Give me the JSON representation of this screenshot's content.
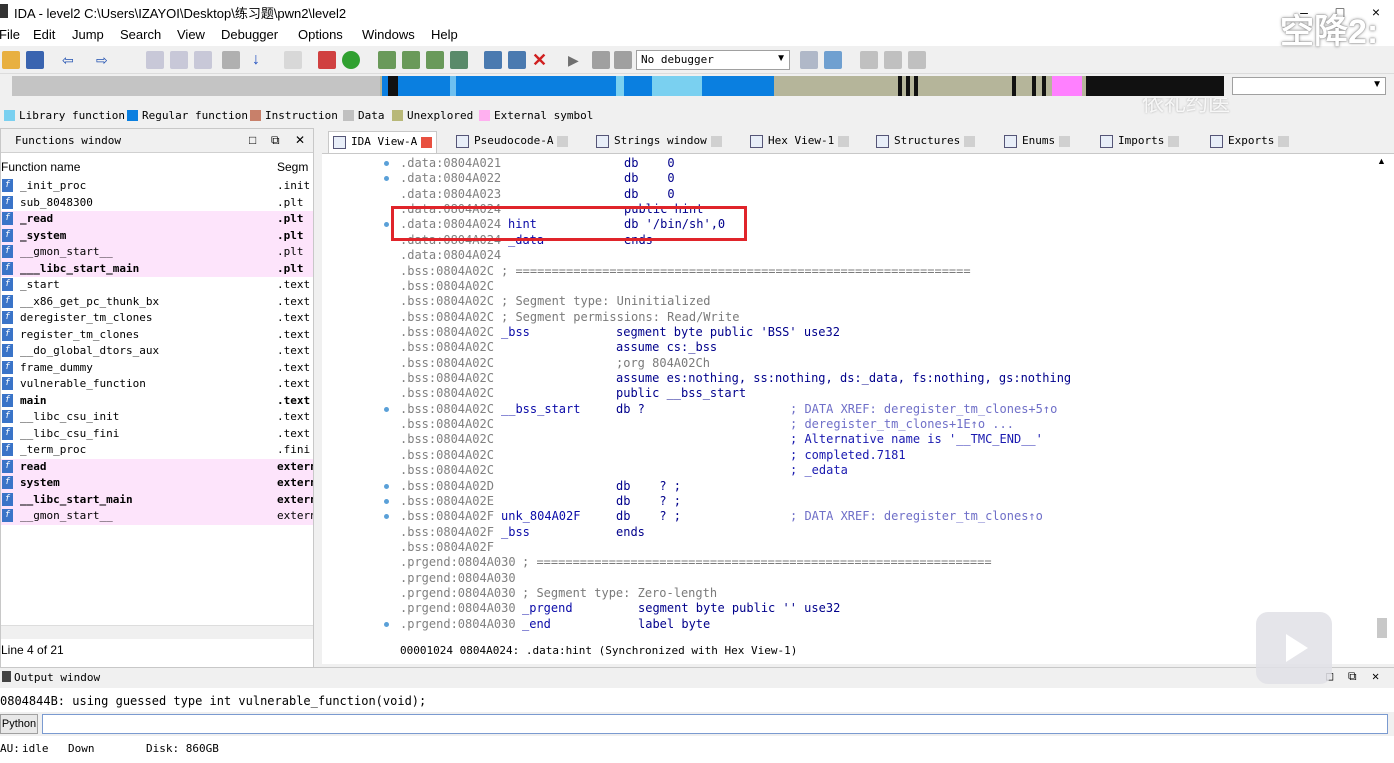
{
  "window": {
    "title": "IDA - level2 C:\\Users\\IZAYOI\\Desktop\\练习题\\pwn2\\level2"
  },
  "watermark": {
    "text": "空降2:",
    "sub": "依礼约医"
  },
  "menu": [
    "File",
    "Edit",
    "Jump",
    "Search",
    "View",
    "Debugger",
    "Options",
    "Windows",
    "Help"
  ],
  "toolbar": {
    "debugger": "No debugger"
  },
  "legend": [
    {
      "label": "Library function",
      "color": "#7ad0f0"
    },
    {
      "label": "Regular function",
      "color": "#0a7fe0"
    },
    {
      "label": "Instruction",
      "color": "#c8806a"
    },
    {
      "label": "Data",
      "color": "#c0c0c0"
    },
    {
      "label": "Unexplored",
      "color": "#b8b878"
    },
    {
      "label": "External symbol",
      "color": "#ffb0f0"
    }
  ],
  "functions_window": {
    "title": "Functions window",
    "col_name": "Function name",
    "col_seg": "Segm",
    "status": "Line 4 of 21",
    "rows": [
      {
        "name": "_init_proc",
        "seg": ".init",
        "pink": false,
        "bold": false
      },
      {
        "name": "sub_8048300",
        "seg": ".plt",
        "pink": false,
        "bold": false
      },
      {
        "name": "_read",
        "seg": ".plt",
        "pink": true,
        "bold": true
      },
      {
        "name": "_system",
        "seg": ".plt",
        "pink": true,
        "bold": true
      },
      {
        "name": "__gmon_start__",
        "seg": ".plt",
        "pink": true,
        "bold": false
      },
      {
        "name": "___libc_start_main",
        "seg": ".plt",
        "pink": true,
        "bold": true
      },
      {
        "name": "_start",
        "seg": ".text",
        "pink": false,
        "bold": false
      },
      {
        "name": "__x86_get_pc_thunk_bx",
        "seg": ".text",
        "pink": false,
        "bold": false
      },
      {
        "name": "deregister_tm_clones",
        "seg": ".text",
        "pink": false,
        "bold": false
      },
      {
        "name": "register_tm_clones",
        "seg": ".text",
        "pink": false,
        "bold": false
      },
      {
        "name": "__do_global_dtors_aux",
        "seg": ".text",
        "pink": false,
        "bold": false
      },
      {
        "name": "frame_dummy",
        "seg": ".text",
        "pink": false,
        "bold": false
      },
      {
        "name": "vulnerable_function",
        "seg": ".text",
        "pink": false,
        "bold": false
      },
      {
        "name": "main",
        "seg": ".text",
        "pink": false,
        "bold": true
      },
      {
        "name": "__libc_csu_init",
        "seg": ".text",
        "pink": false,
        "bold": false
      },
      {
        "name": "__libc_csu_fini",
        "seg": ".text",
        "pink": false,
        "bold": false
      },
      {
        "name": "_term_proc",
        "seg": ".fini",
        "pink": false,
        "bold": false
      },
      {
        "name": "read",
        "seg": "extern",
        "pink": true,
        "bold": true
      },
      {
        "name": "system",
        "seg": "extern",
        "pink": true,
        "bold": true
      },
      {
        "name": "__libc_start_main",
        "seg": "extern",
        "pink": true,
        "bold": true
      },
      {
        "name": "__gmon_start__",
        "seg": "extern",
        "pink": true,
        "bold": false
      }
    ]
  },
  "tabs": [
    "IDA View-A",
    "Pseudocode-A",
    "Strings window",
    "Hex View-1",
    "Structures",
    "Enums",
    "Imports",
    "Exports"
  ],
  "ida_view": {
    "status": "00001024 0804A024: .data:hint (Synchronized with Hex View-1)",
    "lines": [
      {
        "addr": ".data:0804A021",
        "c1": "",
        "c2": "db    0",
        "c3": ""
      },
      {
        "addr": ".data:0804A022",
        "c1": "",
        "c2": "db    0",
        "c3": ""
      },
      {
        "addr": ".data:0804A023",
        "c1": "",
        "c2": "db    0",
        "c3": ""
      },
      {
        "addr": ".data:0804A024",
        "c1": "",
        "c2": "public hint",
        "c3": ""
      },
      {
        "addr": ".data:0804A024",
        "c1": "hint",
        "c2": "db '/bin/sh',0",
        "c3": ""
      },
      {
        "addr": ".data:0804A024",
        "c1": "_data",
        "c2": "ends",
        "c3": ""
      },
      {
        "addr": ".data:0804A024",
        "c1": "",
        "c2": "",
        "c3": ""
      },
      {
        "addr": ".bss:0804A02C",
        "c1": "; ===============================================================",
        "c2": "",
        "c3": ""
      },
      {
        "addr": ".bss:0804A02C",
        "c1": "",
        "c2": "",
        "c3": ""
      },
      {
        "addr": ".bss:0804A02C",
        "c1": "; Segment type: Uninitialized",
        "c2": "",
        "c3": ""
      },
      {
        "addr": ".bss:0804A02C",
        "c1": "; Segment permissions: Read/Write",
        "c2": "",
        "c3": ""
      },
      {
        "addr": ".bss:0804A02C",
        "c1": "_bss",
        "c2": "segment byte public 'BSS' use32",
        "c3": ""
      },
      {
        "addr": ".bss:0804A02C",
        "c1": "",
        "c2": "assume cs:_bss",
        "c3": ""
      },
      {
        "addr": ".bss:0804A02C",
        "c1": "",
        "c2": ";org 804A02Ch",
        "c3": ""
      },
      {
        "addr": ".bss:0804A02C",
        "c1": "",
        "c2": "assume es:nothing, ss:nothing, ds:_data, fs:nothing, gs:nothing",
        "c3": ""
      },
      {
        "addr": ".bss:0804A02C",
        "c1": "",
        "c2": "public __bss_start",
        "c3": ""
      },
      {
        "addr": ".bss:0804A02C",
        "c1": "__bss_start",
        "c2": "db ?",
        "c3": "; DATA XREF: deregister_tm_clones+5↑o"
      },
      {
        "addr": ".bss:0804A02C",
        "c1": "",
        "c2": "",
        "c3": "; deregister_tm_clones+1E↑o ..."
      },
      {
        "addr": ".bss:0804A02C",
        "c1": "",
        "c2": "",
        "c3": "; Alternative name is '__TMC_END__'"
      },
      {
        "addr": ".bss:0804A02C",
        "c1": "",
        "c2": "",
        "c3": "; completed.7181"
      },
      {
        "addr": ".bss:0804A02C",
        "c1": "",
        "c2": "",
        "c3": "; _edata"
      },
      {
        "addr": ".bss:0804A02D",
        "c1": "",
        "c2": "db    ? ;",
        "c3": ""
      },
      {
        "addr": ".bss:0804A02E",
        "c1": "",
        "c2": "db    ? ;",
        "c3": ""
      },
      {
        "addr": ".bss:0804A02F",
        "c1": "unk_804A02F",
        "c2": "db    ? ;",
        "c3": "; DATA XREF: deregister_tm_clones↑o"
      },
      {
        "addr": ".bss:0804A02F",
        "c1": "_bss",
        "c2": "ends",
        "c3": ""
      },
      {
        "addr": ".bss:0804A02F",
        "c1": "",
        "c2": "",
        "c3": ""
      },
      {
        "addr": ".prgend:0804A030",
        "c1": "; ===============================================================",
        "c2": "",
        "c3": ""
      },
      {
        "addr": ".prgend:0804A030",
        "c1": "",
        "c2": "",
        "c3": ""
      },
      {
        "addr": ".prgend:0804A030",
        "c1": "; Segment type: Zero-length",
        "c2": "",
        "c3": ""
      },
      {
        "addr": ".prgend:0804A030",
        "c1": "_prgend",
        "c2": "segment byte public '' use32",
        "c3": ""
      },
      {
        "addr": ".prgend:0804A030",
        "c1": "_end",
        "c2": "label byte",
        "c3": ""
      }
    ]
  },
  "output": {
    "title": "Output window",
    "line": "0804844B: using guessed type int vulnerable_function(void);",
    "python_btn": "Python",
    "status_au": "AU:",
    "status_state": "idle",
    "status_dir": "Down",
    "status_disk": "Disk: 860GB"
  }
}
